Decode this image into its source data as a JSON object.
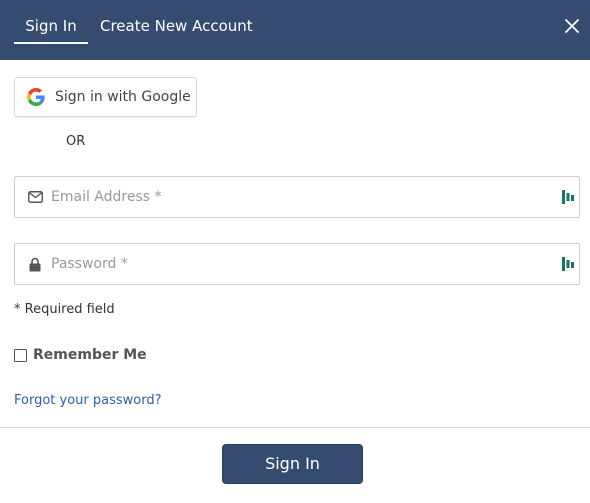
{
  "tabs": [
    {
      "label": "Sign In",
      "active": true
    },
    {
      "label": "Create New Account",
      "active": false
    }
  ],
  "close_icon": "close-icon",
  "google_button": {
    "label": "Sign in with Google",
    "icon": "google-g-icon"
  },
  "separator": "OR",
  "email_field": {
    "placeholder": "Email Address *",
    "value": "",
    "icon": "envelope-icon"
  },
  "password_field": {
    "placeholder": "Password *",
    "value": "",
    "icon": "lock-icon"
  },
  "required_note": "* Required field",
  "remember_me": {
    "label": "Remember Me",
    "checked": false
  },
  "forgot_password": "Forgot your password?",
  "submit_label": "Sign In",
  "colors": {
    "header_bg": "#354b70",
    "link": "#2f5fa0",
    "password_manager_icon": "#1f6f6a"
  }
}
